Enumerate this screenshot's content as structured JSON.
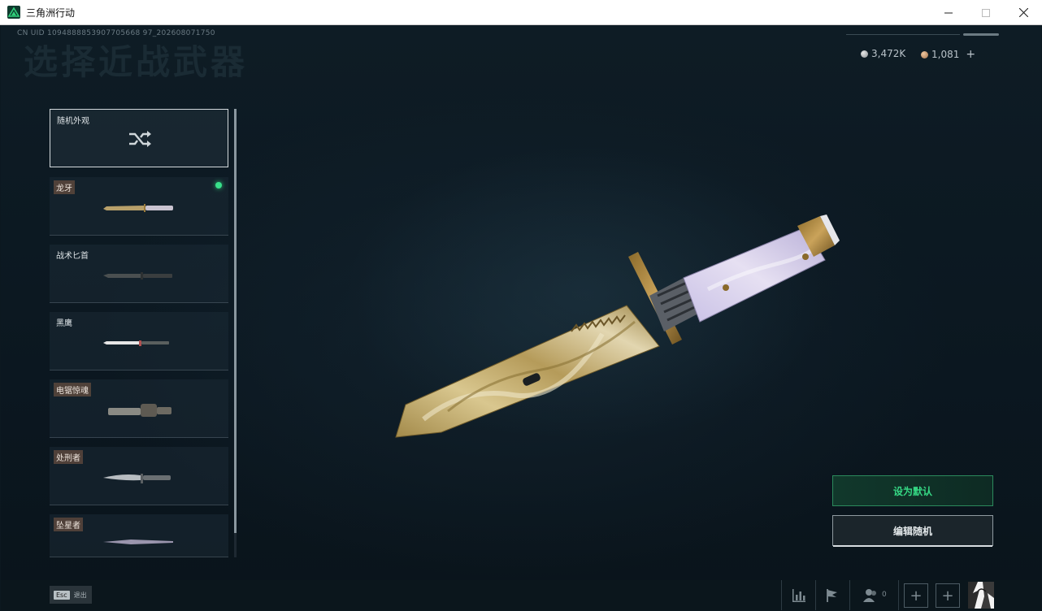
{
  "window": {
    "title": "三角洲行动",
    "controls": [
      "minimize",
      "maximize",
      "close"
    ]
  },
  "header": {
    "uid": "CN UID 1094888853907705668 97_202608071750",
    "page_title": "选择近战武器"
  },
  "currency": [
    {
      "icon": "silver-coin-icon",
      "value": "3,472K"
    },
    {
      "icon": "bronze-coin-icon",
      "value": "1,081"
    }
  ],
  "currency_add": "+",
  "weapons": [
    {
      "label": "随机外观",
      "type": "random",
      "selected": true
    },
    {
      "label": "龙牙",
      "equipped": true
    },
    {
      "label": "战术匕首"
    },
    {
      "label": "黑鹰"
    },
    {
      "label": "电锯惊魂"
    },
    {
      "label": "处刑者"
    },
    {
      "label": "坠星者"
    }
  ],
  "actions": {
    "set_default": "设为默认",
    "edit_random": "编辑随机"
  },
  "bottom": {
    "esc_key": "Esc",
    "esc_label": "退出",
    "friends_count": "0"
  },
  "colors": {
    "accent": "#36d985",
    "equipped_dot": "#38e08a",
    "background": "#0c1820"
  }
}
